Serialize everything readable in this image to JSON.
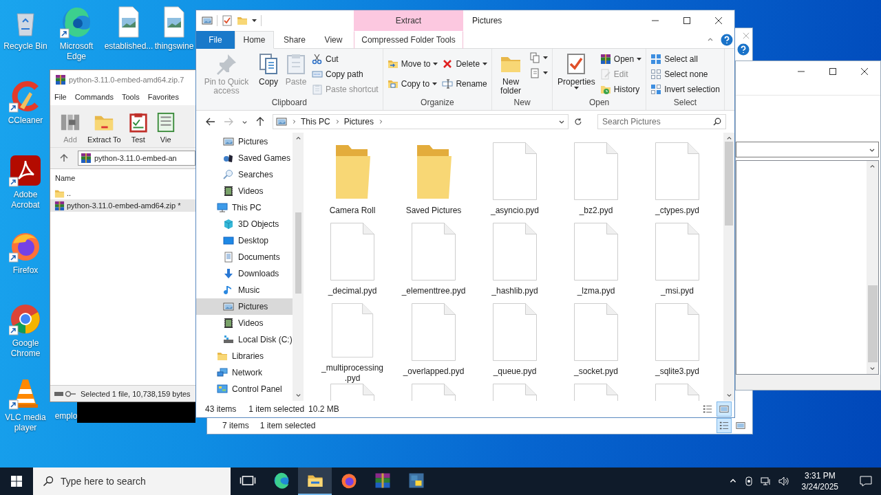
{
  "desktop": {
    "icons": [
      {
        "label": "Recycle Bin",
        "kind": "recycle"
      },
      {
        "label": "Microsoft Edge",
        "kind": "edge"
      },
      {
        "label": "established...",
        "kind": "image-file"
      },
      {
        "label": "thingswine",
        "kind": "image-file"
      },
      {
        "label": "CCleaner",
        "kind": "ccleaner"
      },
      {
        "label": "Adobe Acrobat",
        "kind": "acrobat"
      },
      {
        "label": "Firefox",
        "kind": "firefox"
      },
      {
        "label": "Google Chrome",
        "kind": "chrome"
      },
      {
        "label": "VLC media player",
        "kind": "vlc"
      },
      {
        "label": "emplo"
      }
    ]
  },
  "back_explorer": {
    "status_items": "7 items",
    "status_selected": "1 item selected",
    "view_buttons": [
      {
        "kind": "details",
        "selected": true
      },
      {
        "kind": "large-icons",
        "selected": false
      }
    ]
  },
  "winrar": {
    "title": "python-3.11.0-embed-amd64.zip.7",
    "menu": [
      "File",
      "Commands",
      "Tools",
      "Favorites"
    ],
    "toolbar": [
      {
        "label": "Add",
        "kind": "add",
        "disabled": true
      },
      {
        "label": "Extract To",
        "kind": "extract",
        "disabled": false
      },
      {
        "label": "Test",
        "kind": "test",
        "disabled": false
      },
      {
        "label": "Vie",
        "kind": "view",
        "disabled": false
      }
    ],
    "path": "python-3.11.0-embed-an",
    "column": "Name",
    "rows": [
      {
        "name": "..",
        "kind": "folder",
        "selected": false
      },
      {
        "name": "python-3.11.0-embed-amd64.zip *",
        "kind": "archive",
        "selected": true
      }
    ],
    "status": "Selected 1 file, 10,738,159 bytes"
  },
  "explorer": {
    "title": "Pictures",
    "context_tab": "Extract",
    "tabs": [
      {
        "label": "File",
        "kind": "file",
        "selected": false
      },
      {
        "label": "Home",
        "kind": "tab",
        "selected": true
      },
      {
        "label": "Share",
        "kind": "tab",
        "selected": false
      },
      {
        "label": "View",
        "kind": "tab",
        "selected": false
      },
      {
        "label": "Compressed Folder Tools",
        "kind": "context",
        "selected": false
      }
    ],
    "groups": [
      {
        "label": "Clipboard",
        "columns": [
          {
            "label": "Pin to Quick access",
            "kind": "pin",
            "disabled": true
          },
          {
            "label": "Copy",
            "kind": "copy",
            "disabled": false
          },
          {
            "label": "Paste",
            "kind": "paste",
            "disabled": true
          },
          {
            "items": [
              {
                "label": "Cut",
                "kind": "cut",
                "disabled": false
              },
              {
                "label": "Copy path",
                "kind": "copy-path",
                "disabled": false
              },
              {
                "label": "Paste shortcut",
                "kind": "paste-shortcut",
                "disabled": true
              }
            ]
          }
        ]
      },
      {
        "label": "Organize",
        "columns": [
          {
            "items": [
              {
                "label": "Move to",
                "kind": "move-to",
                "disabled": false,
                "dropdown": true
              },
              {
                "label": "Copy to",
                "kind": "copy-to",
                "disabled": false,
                "dropdown": true
              }
            ]
          },
          {
            "items": [
              {
                "label": "Delete",
                "kind": "delete",
                "disabled": false,
                "dropdown": true
              },
              {
                "label": "Rename",
                "kind": "rename",
                "disabled": false
              }
            ]
          }
        ]
      },
      {
        "label": "New",
        "columns": [
          {
            "label": "New folder",
            "kind": "new-folder",
            "disabled": false
          },
          {
            "items": [
              {
                "kind": "new-item",
                "disabled": false,
                "dropdown": true
              },
              {
                "kind": "easy-access",
                "disabled": false,
                "dropdown": true
              }
            ]
          }
        ]
      },
      {
        "label": "Open",
        "columns": [
          {
            "label": "Properties",
            "kind": "properties",
            "disabled": false,
            "dropdown": true
          },
          {
            "items": [
              {
                "label": "Open",
                "kind": "open",
                "disabled": false,
                "dropdown": true
              },
              {
                "label": "Edit",
                "kind": "edit",
                "disabled": true
              },
              {
                "label": "History",
                "kind": "history",
                "disabled": false
              }
            ]
          }
        ]
      },
      {
        "label": "Select",
        "columns": [
          {
            "items": [
              {
                "label": "Select all",
                "kind": "select-all",
                "disabled": false
              },
              {
                "label": "Select none",
                "kind": "select-none",
                "disabled": false
              },
              {
                "label": "Invert selection",
                "kind": "invert",
                "disabled": false
              }
            ]
          }
        ]
      }
    ],
    "address": [
      "This PC",
      "Pictures"
    ],
    "search_placeholder": "Search Pictures",
    "nav": [
      {
        "children": [
          {
            "label": "Pictures",
            "kind": "pictures",
            "selected": false
          },
          {
            "label": "Saved Games",
            "kind": "games",
            "selected": false
          },
          {
            "label": "Searches",
            "kind": "searches",
            "selected": false
          },
          {
            "label": "Videos",
            "kind": "videos",
            "selected": false
          }
        ]
      },
      {
        "label": "This PC",
        "kind": "pc",
        "selected": false,
        "children": [
          {
            "label": "3D Objects",
            "kind": "cube",
            "selected": false
          },
          {
            "label": "Desktop",
            "kind": "desktop",
            "selected": false
          },
          {
            "label": "Documents",
            "kind": "documents",
            "selected": false
          },
          {
            "label": "Downloads",
            "kind": "downloads",
            "selected": false
          },
          {
            "label": "Music",
            "kind": "music",
            "selected": false
          },
          {
            "label": "Pictures",
            "kind": "pictures",
            "selected": true
          },
          {
            "label": "Videos",
            "kind": "videos",
            "selected": false
          },
          {
            "label": "Local Disk (C:)",
            "kind": "disk",
            "selected": false
          }
        ]
      },
      {
        "label": "Libraries",
        "kind": "libraries",
        "selected": false
      },
      {
        "label": "Network",
        "kind": "network",
        "selected": false
      },
      {
        "label": "Control Panel",
        "kind": "control-panel",
        "selected": false
      }
    ],
    "items": [
      {
        "name": "Camera Roll",
        "kind": "folder"
      },
      {
        "name": "Saved Pictures",
        "kind": "folder"
      },
      {
        "name": "_asyncio.pyd",
        "kind": "file"
      },
      {
        "name": "_bz2.pyd",
        "kind": "file"
      },
      {
        "name": "_ctypes.pyd",
        "kind": "file"
      },
      {
        "name": "_decimal.pyd",
        "kind": "file"
      },
      {
        "name": "_elementtree.pyd",
        "kind": "file"
      },
      {
        "name": "_hashlib.pyd",
        "kind": "file"
      },
      {
        "name": "_lzma.pyd",
        "kind": "file"
      },
      {
        "name": "_msi.pyd",
        "kind": "file"
      },
      {
        "name": "_multiprocessing.pyd",
        "kind": "file"
      },
      {
        "name": "_overlapped.pyd",
        "kind": "file"
      },
      {
        "name": "_queue.pyd",
        "kind": "file"
      },
      {
        "name": "_socket.pyd",
        "kind": "file"
      },
      {
        "name": "_sqlite3.pyd",
        "kind": "file"
      },
      {
        "kind": "file"
      },
      {
        "kind": "file"
      },
      {
        "kind": "file"
      },
      {
        "kind": "file"
      },
      {
        "kind": "file"
      }
    ],
    "status_items": "43 items",
    "status_selected": "1 item selected",
    "status_size": "10.2 MB",
    "view_buttons": [
      {
        "kind": "details",
        "selected": false
      },
      {
        "kind": "large-icons",
        "selected": true
      }
    ]
  },
  "taskbar": {
    "search_placeholder": "Type here to search",
    "apps": [
      {
        "kind": "task-view",
        "active": false
      },
      {
        "kind": "edge",
        "active": false
      },
      {
        "kind": "explorer",
        "active": true
      },
      {
        "kind": "firefox",
        "active": false
      },
      {
        "kind": "winrar",
        "active": false
      },
      {
        "kind": "python",
        "active": false
      }
    ],
    "time": "3:31 PM",
    "date": "3/24/2025"
  }
}
